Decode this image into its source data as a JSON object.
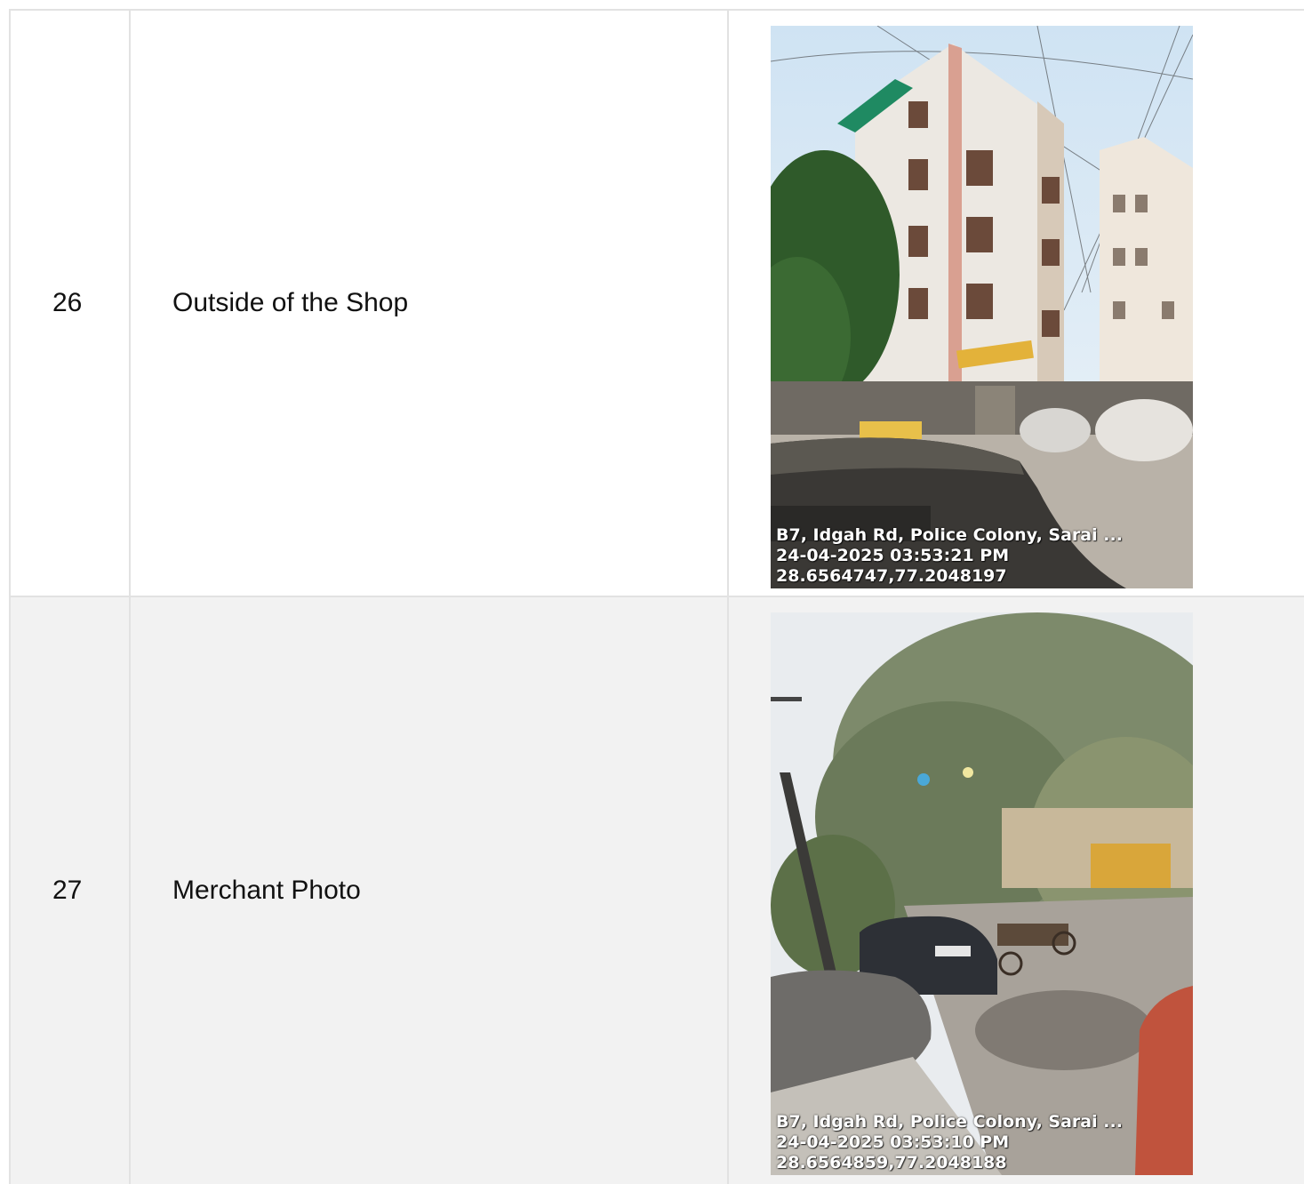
{
  "rows": [
    {
      "number": "26",
      "label": "Outside of the Shop",
      "stamp": {
        "address": "B7, Idgah Rd, Police Colony, Sarai ...",
        "datetime": "24-04-2025 03:53:21 PM",
        "coords": "28.6564747,77.2048197"
      }
    },
    {
      "number": "27",
      "label": "Merchant Photo",
      "stamp": {
        "address": "B7, Idgah Rd, Police Colony, Sarai ...",
        "datetime": "24-04-2025 03:53:10 PM",
        "coords": "28.6564859,77.2048188"
      }
    }
  ],
  "colors": {
    "grid_border": "#e2e2e2",
    "alt_row_bg": "#f2f2f2"
  }
}
